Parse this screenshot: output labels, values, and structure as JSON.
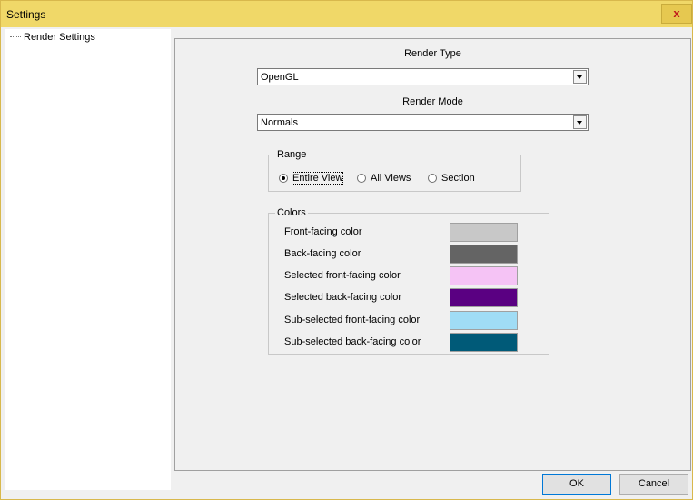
{
  "window": {
    "title": "Settings",
    "close_glyph": "x"
  },
  "tree": {
    "items": [
      {
        "label": "Render Settings"
      }
    ]
  },
  "render_type": {
    "label": "Render Type",
    "value": "OpenGL"
  },
  "render_mode": {
    "label": "Render Mode",
    "value": "Normals"
  },
  "range": {
    "legend": "Range",
    "options": [
      {
        "label": "Entire View",
        "checked": true
      },
      {
        "label": "All Views",
        "checked": false
      },
      {
        "label": "Section",
        "checked": false
      }
    ]
  },
  "colors": {
    "legend": "Colors",
    "items": [
      {
        "label": "Front-facing color",
        "color": "#c8c8c8"
      },
      {
        "label": "Back-facing color",
        "color": "#646464"
      },
      {
        "label": "Selected front-facing color",
        "color": "#f5c3f5"
      },
      {
        "label": "Selected back-facing color",
        "color": "#5a0082"
      },
      {
        "label": "Sub-selected front-facing color",
        "color": "#a0dcf5"
      },
      {
        "label": "Sub-selected back-facing color",
        "color": "#005a78"
      }
    ]
  },
  "buttons": {
    "ok_label": "OK",
    "cancel_label": "Cancel"
  }
}
